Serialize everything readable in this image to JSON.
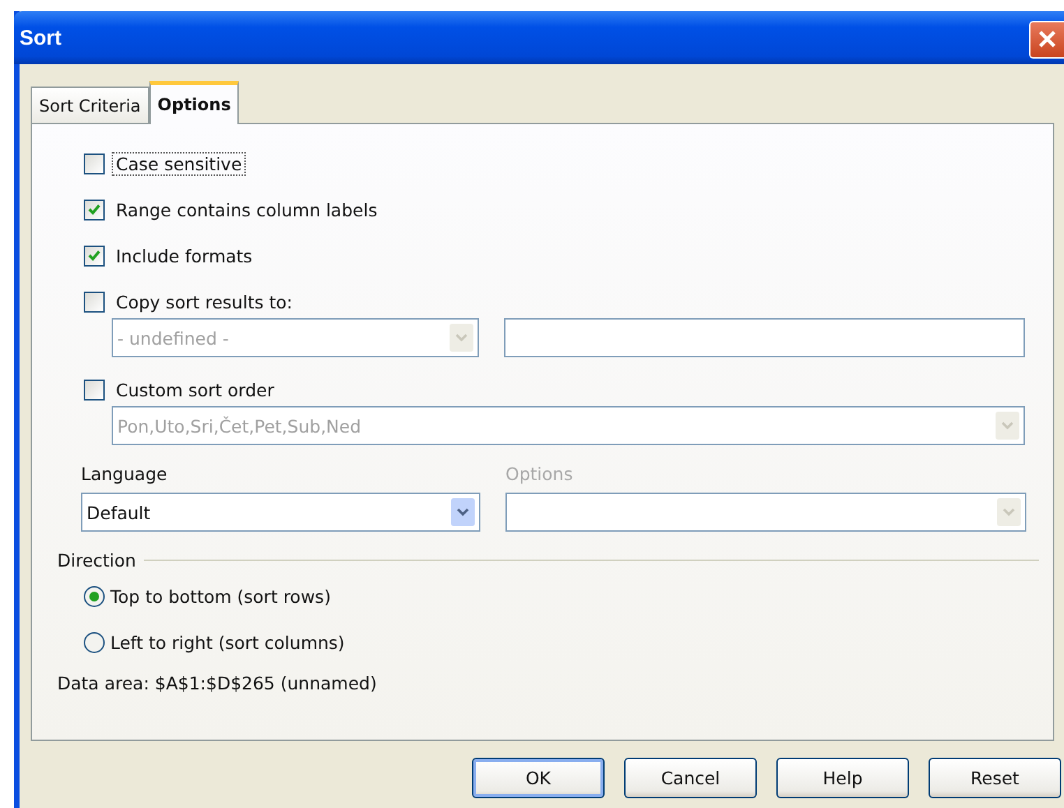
{
  "window": {
    "title": "Sort"
  },
  "tabs": [
    {
      "label": "Sort Criteria",
      "selected": false
    },
    {
      "label": "Options",
      "selected": true
    }
  ],
  "items": [
    {
      "kind": "checkbox",
      "label": "Case sensitive",
      "checked": false,
      "focused": true
    },
    {
      "kind": "checkbox",
      "label": "Range contains column labels",
      "checked": true,
      "focused": false
    },
    {
      "kind": "checkbox",
      "label": "Include formats",
      "checked": true,
      "focused": false
    },
    {
      "kind": "checkbox",
      "label": "Copy sort results to:",
      "checked": false,
      "focused": false
    },
    {
      "kind": "target",
      "value": "- undefined -",
      "disabled": true
    },
    {
      "kind": "checkbox",
      "label": "Custom sort order",
      "checked": false,
      "focused": false
    },
    {
      "kind": "combo",
      "value": "Pon,Uto,Sri,Čet,Pet,Sub,Ned",
      "disabled": true
    }
  ],
  "language": {
    "label": "Language",
    "value": "Default",
    "disabled": false
  },
  "options_combo": {
    "label": "Options",
    "disabled": true
  },
  "direction": {
    "title": "Direction",
    "radios": [
      {
        "label": "Top to bottom (sort rows)",
        "selected": true
      },
      {
        "label": "Left to right (sort columns)",
        "selected": false
      }
    ]
  },
  "data_area": "Data area: $A$1:$D$265 (unnamed)",
  "buttons": [
    {
      "label": "OK",
      "default": true
    },
    {
      "label": "Cancel",
      "default": false
    },
    {
      "label": "Help",
      "default": false
    },
    {
      "label": "Reset",
      "default": false
    }
  ]
}
